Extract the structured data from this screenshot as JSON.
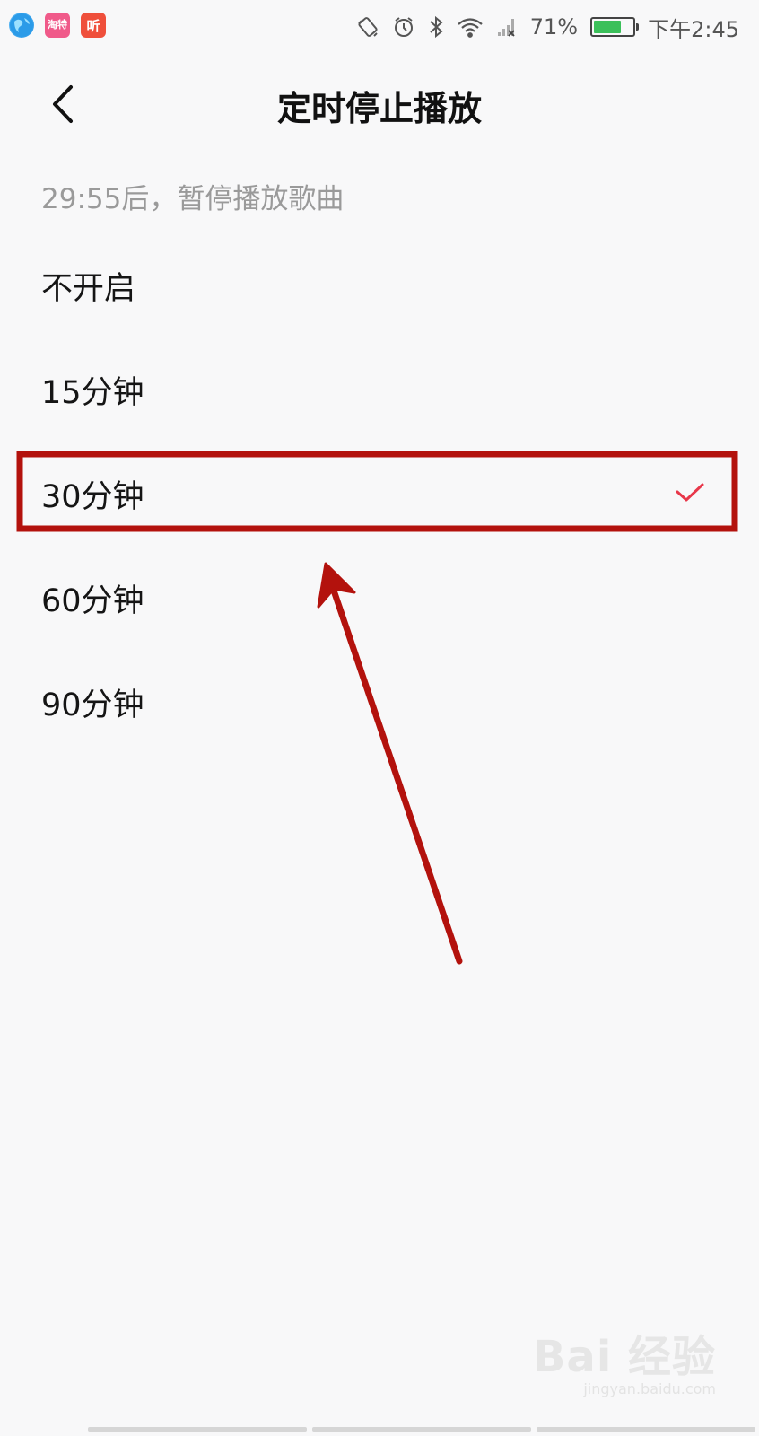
{
  "status_bar": {
    "apps": [
      {
        "icon": "browser-globe-icon",
        "label": ""
      },
      {
        "icon": "taote-app-icon",
        "label": "淘特"
      },
      {
        "icon": "ting-app-icon",
        "label": "听"
      }
    ],
    "battery_percent": "71%",
    "battery_level": 0.71,
    "time": "下午2:45"
  },
  "header": {
    "title": "定时停止播放"
  },
  "countdown_text": "29:55后，暂停播放歌曲",
  "options": [
    {
      "label": "不开启",
      "selected": false
    },
    {
      "label": "15分钟",
      "selected": false
    },
    {
      "label": "30分钟",
      "selected": true
    },
    {
      "label": "60分钟",
      "selected": false
    },
    {
      "label": "90分钟",
      "selected": false
    }
  ],
  "colors": {
    "accent_check": "#e8374a",
    "annotation": "#b3120d",
    "background": "#f8f8f9"
  },
  "watermark": {
    "main": "Bai 经验",
    "sub": "jingyan.baidu.com"
  }
}
